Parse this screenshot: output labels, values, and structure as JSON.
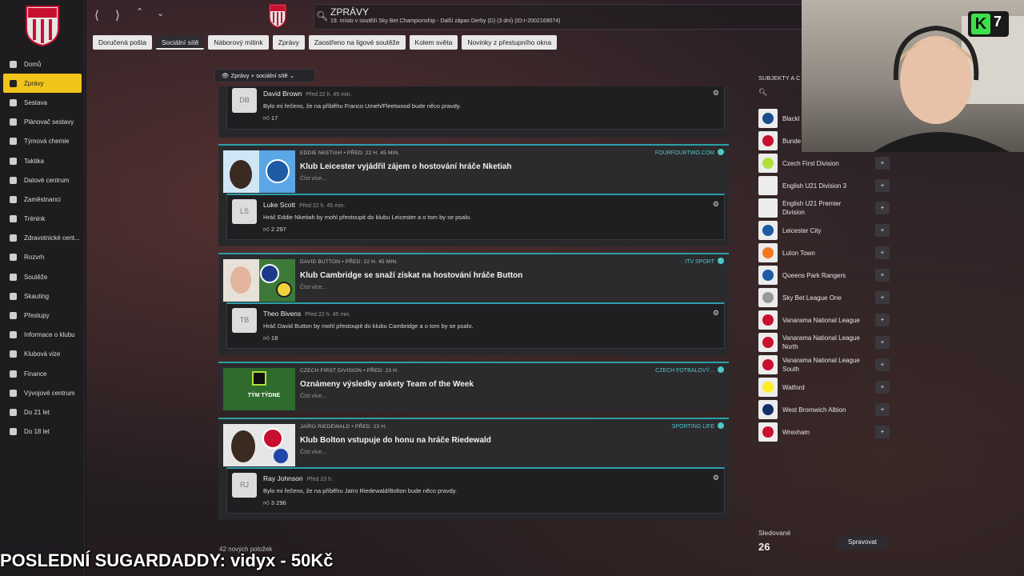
{
  "header": {
    "title": "ZPRÁVY",
    "subtitle": "19. místo v soutěži Sky Bet Championship - Další zápas Derby (D) (3 dní) (ID:r-2002169074)"
  },
  "tabs": [
    {
      "label": "Doručená pošta"
    },
    {
      "label": "Sociální sítě",
      "active": true
    },
    {
      "label": "Náborový mítink"
    },
    {
      "label": "Zprávy"
    },
    {
      "label": "Zaostřeno na ligové soutěže"
    },
    {
      "label": "Kolem světa"
    },
    {
      "label": "Novinky z přestupního okna"
    }
  ],
  "filter_label": "Zprávy + sociální sítě",
  "sidebar": {
    "items": [
      {
        "label": "Domů",
        "icon": "home-icon"
      },
      {
        "label": "Zprávy",
        "icon": "mail-icon",
        "active": true
      },
      {
        "label": "Sestava",
        "icon": "shirt-icon"
      },
      {
        "label": "Plánovač sestavy",
        "icon": "planner-icon"
      },
      {
        "label": "Týmová chemie",
        "icon": "chemistry-icon"
      },
      {
        "label": "Taktika",
        "icon": "tactics-icon"
      },
      {
        "label": "Datové centrum",
        "icon": "data-icon"
      },
      {
        "label": "Zaměstnanci",
        "icon": "staff-icon"
      },
      {
        "label": "Trénink",
        "icon": "training-icon"
      },
      {
        "label": "Zdravotnické cent...",
        "icon": "medical-icon"
      },
      {
        "label": "Rozvrh",
        "icon": "calendar-icon"
      },
      {
        "label": "Soutěže",
        "icon": "trophy-icon"
      },
      {
        "label": "Skauting",
        "icon": "scouting-icon"
      },
      {
        "label": "Přestupy",
        "icon": "transfer-icon"
      },
      {
        "label": "Informace o klubu",
        "icon": "shield-icon"
      },
      {
        "label": "Klubová vize",
        "icon": "vision-icon"
      },
      {
        "label": "Finance",
        "icon": "finance-icon"
      },
      {
        "label": "Vývojové centrum",
        "icon": "development-icon"
      },
      {
        "label": "Do 21 let",
        "icon": "u21-icon"
      },
      {
        "label": "Do 18 let",
        "icon": "u18-icon"
      }
    ]
  },
  "feed": {
    "first_reply": {
      "initials": "DB",
      "name": "David Brown",
      "time": "Před 22 h. 45 min.",
      "body": "Bylo mi řečeno, že na příběhu Franco Umeh/Fleetwood bude něco pravdy.",
      "likes": "17"
    },
    "stories": [
      {
        "kicker": "Eddie Nketiah • Před: 22 h. 45 min.",
        "title": "Klub Leicester vyjádřil zájem o hostování hráče Nketiah",
        "more": "Číst více...",
        "source": "FOURFOURTWO.COM",
        "reply": {
          "initials": "LS",
          "name": "Luke Scott",
          "time": "Před 22 h. 45 min.",
          "body": "Hráč Eddie Nketiah by mohl přestoupit do klubu Leicester a o tom by se psalo.",
          "likes": "2 297"
        }
      },
      {
        "kicker": "David Button • Před: 22 h. 45 min.",
        "title": "Klub Cambridge se snaží získat na hostování hráče Button",
        "more": "Číst více...",
        "source": "ITV SPORT",
        "reply": {
          "initials": "TB",
          "name": "Theo Bivens",
          "time": "Před 22 h. 45 min.",
          "body": "Hráč David Button by mohl přestoupit do klubu Cambridge a o tom by se psalo.",
          "likes": "18"
        }
      },
      {
        "kicker": "Czech First Division • Před: 23 h.",
        "title": "Oznámeny výsledky ankety Team of the Week",
        "more": "Číst více...",
        "source": "CZECH FOTBALOVÝ...",
        "thumb_text": "TÝM TÝDNE"
      },
      {
        "kicker": "Jaïro Riedewald • Před: 23 h.",
        "title": "Klub Bolton vstupuje do honu na hráče Riedewald",
        "more": "Číst více...",
        "source": "SPORTING LIFE",
        "reply": {
          "initials": "RJ",
          "name": "Ray Johnson",
          "time": "Před 23 h.",
          "body": "Bylo mi řečeno, že na příběhu Jaïro Riedewald/Bolton bude něco pravdy.",
          "likes": "3 296"
        }
      }
    ],
    "count_text": "42 nových položek"
  },
  "right_panel": {
    "title": "SUBJEKTY A C",
    "items": [
      {
        "label": "Blackl",
        "color": "#1a4c8c"
      },
      {
        "label": "Bunde",
        "color": "#c8102e"
      },
      {
        "label": "Czech First Division",
        "color": "#b2e03a"
      },
      {
        "label": "English U21 Division 3",
        "color": "#ececec"
      },
      {
        "label": "English U21 Premier Division",
        "color": "#ececec"
      },
      {
        "label": "Leicester City",
        "color": "#1d5ba4"
      },
      {
        "label": "Luton Town",
        "color": "#f47a20"
      },
      {
        "label": "Queens Park Rangers",
        "color": "#1d5ba4"
      },
      {
        "label": "Sky Bet League One",
        "color": "#999999"
      },
      {
        "label": "Vanarama National League",
        "color": "#c8102e"
      },
      {
        "label": "Vanarama National League North",
        "color": "#c8102e"
      },
      {
        "label": "Vanarama National League South",
        "color": "#c8102e"
      },
      {
        "label": "Watford",
        "color": "#fbee23"
      },
      {
        "label": "West Bromwich Albion",
        "color": "#122f67"
      },
      {
        "label": "Wrexham",
        "color": "#c8102e"
      }
    ],
    "followed_label": "Sledované",
    "followed_count": "26",
    "manage_label": "Spravovat"
  },
  "stream": {
    "badge_letter": "K",
    "badge_number": "7",
    "overlay": "POSLEDNÍ SUGARDADDY: vidyx - 50Kč"
  },
  "colors": {
    "accent": "#f0c419",
    "teal": "#2b9fa8"
  }
}
